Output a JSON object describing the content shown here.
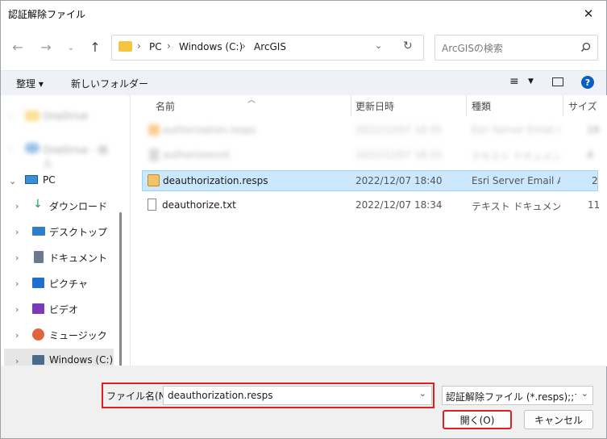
{
  "window": {
    "title": "認証解除ファイル"
  },
  "nav": {
    "breadcrumb": [
      "PC",
      "Windows (C:)",
      "ArcGIS"
    ],
    "search_placeholder": "ArcGISの検索"
  },
  "toolbar": {
    "organize_label": "整理 ▾",
    "new_folder_label": "新しいフォルダー"
  },
  "sidebar": {
    "items": [
      {
        "label": "OneDrive",
        "blurred": true
      },
      {
        "label": "OneDrive - 個人",
        "blurred": true
      },
      {
        "label": "PC"
      },
      {
        "label": "ダウンロード"
      },
      {
        "label": "デスクトップ"
      },
      {
        "label": "ドキュメント"
      },
      {
        "label": "ピクチャ"
      },
      {
        "label": "ビデオ"
      },
      {
        "label": "ミュージック"
      },
      {
        "label": "Windows (C:)"
      }
    ]
  },
  "columns": {
    "name": "名前",
    "modified": "更新日時",
    "type": "種類",
    "size": "サイズ"
  },
  "files": [
    {
      "name": "authorization.resps",
      "modified": "2022/12/07 18:35",
      "type": "Esri Server Email A...",
      "size": "19",
      "blurred": true
    },
    {
      "name": "authorizeevnt",
      "modified": "2022/12/07 18:33",
      "type": "テキスト ドキュメント",
      "size": "4",
      "blurred": true
    },
    {
      "name": "deauthorization.resps",
      "modified": "2022/12/07 18:40",
      "type": "Esri Server Email A...",
      "size": "2",
      "selected": true
    },
    {
      "name": "deauthorize.txt",
      "modified": "2022/12/07 18:34",
      "type": "テキスト ドキュメント",
      "size": "11"
    }
  ],
  "footer": {
    "filename_label": "ファイル名(N):",
    "filename_value": "deauthorization.resps",
    "filter_value": "認証解除ファイル (*.resps);;すべて",
    "open_label": "開く(O)",
    "cancel_label": "キャンセル"
  },
  "colors": {
    "accent": "#0078d4",
    "selection": "#cce8ff",
    "highlight": "#e02020"
  }
}
